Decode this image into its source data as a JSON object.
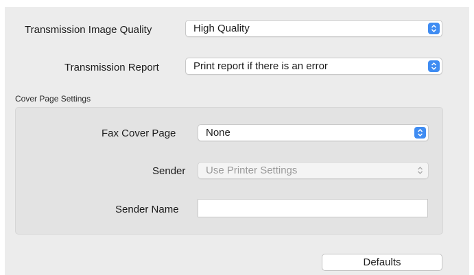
{
  "transmission": {
    "quality_label": "Transmission Image Quality",
    "quality_value": "High Quality",
    "report_label": "Transmission Report",
    "report_value": "Print report if there is an error"
  },
  "cover_page": {
    "section_title": "Cover Page Settings",
    "fax_cover_label": "Fax Cover Page",
    "fax_cover_value": "None",
    "sender_label": "Sender",
    "sender_value": "Use Printer Settings",
    "sender_enabled": false,
    "sender_name_label": "Sender Name",
    "sender_name_value": ""
  },
  "buttons": {
    "defaults_label": "Defaults"
  },
  "icons": {
    "popup_arrows": "chevron-up-down-icon"
  },
  "colors": {
    "accent": "#3f8cf2",
    "panel_bg": "#ececec",
    "group_bg": "#e3e3e3",
    "disabled_text": "#9a9a9a"
  }
}
